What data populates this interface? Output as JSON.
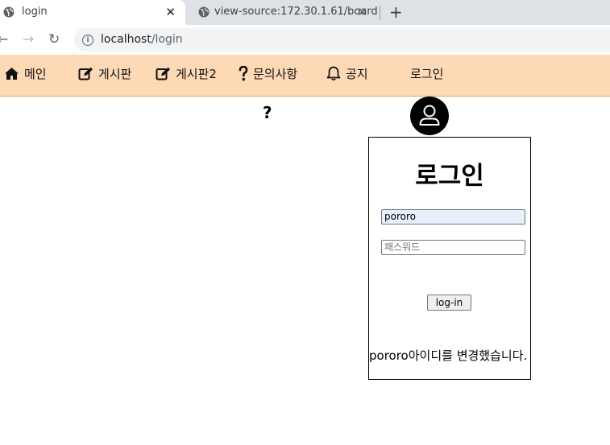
{
  "browser": {
    "tabs": [
      {
        "title": "login",
        "active": true
      },
      {
        "title": "view-source:172.30.1.61/board",
        "active": false
      }
    ],
    "close_glyph": "✕",
    "new_tab_glyph": "+",
    "nav": {
      "back": "←",
      "forward": "→",
      "reload": "↻"
    },
    "info_glyph": "i",
    "url_host": "localhost",
    "url_path": "/login"
  },
  "site_nav": {
    "items": [
      {
        "label": "메인",
        "icon": "home-icon"
      },
      {
        "label": "게시판",
        "icon": "edit-icon"
      },
      {
        "label": "게시판2",
        "icon": "edit-icon"
      },
      {
        "label": "문의사항",
        "icon": "question-icon"
      },
      {
        "label": "공지",
        "icon": "bell-icon"
      },
      {
        "label": "로그인",
        "icon": ""
      }
    ]
  },
  "main": {
    "question_mark": "?",
    "avatar_icon": "user-icon",
    "login": {
      "title": "로그인",
      "id_value": "pororo",
      "password_placeholder": "패스워드",
      "button_label": "log-in",
      "message": "pororo아이디를 변경했습니다."
    }
  },
  "colors": {
    "nav_background": "#fdd9b5",
    "autofill_background": "#e8f0fe"
  }
}
